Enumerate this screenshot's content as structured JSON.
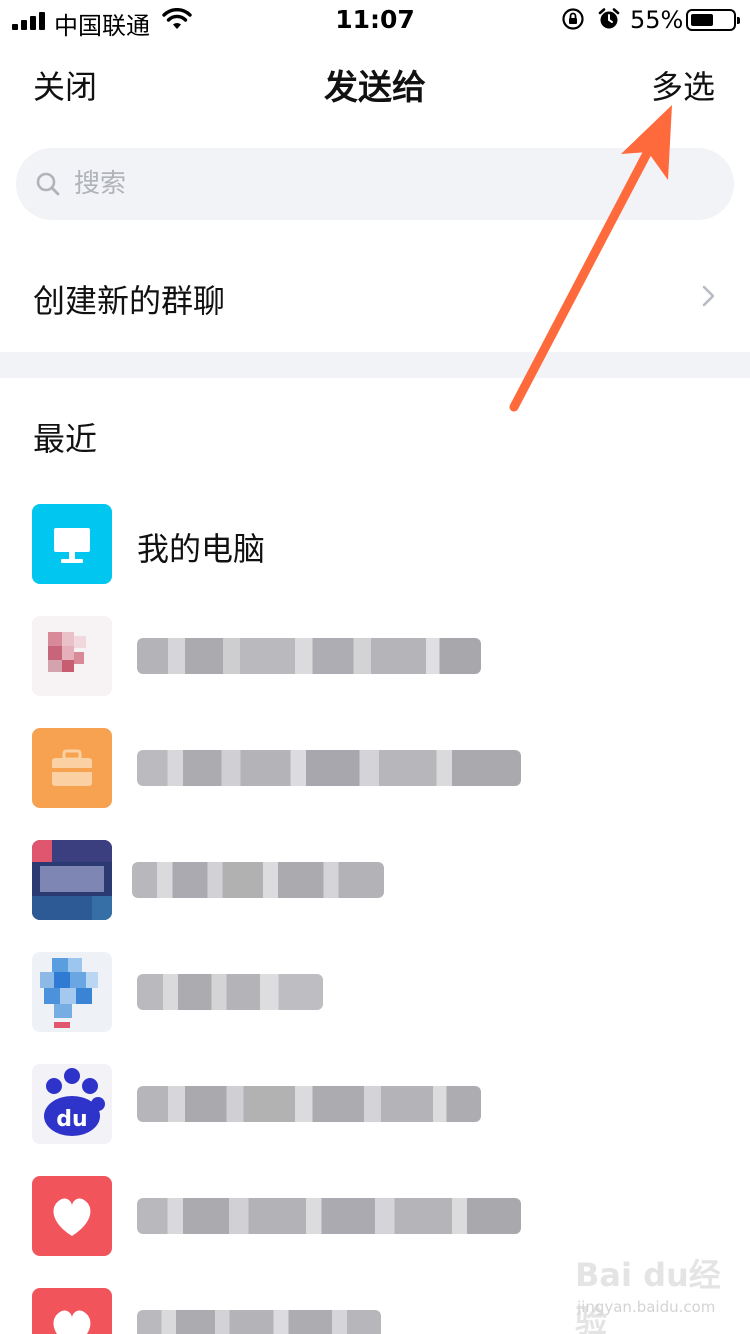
{
  "status_bar": {
    "carrier": "中国联通",
    "time": "11:07",
    "battery_percent": "55%",
    "battery_level": 0.55
  },
  "nav": {
    "close_label": "关闭",
    "title": "发送给",
    "multi_select_label": "多选"
  },
  "search": {
    "placeholder": "搜索"
  },
  "create_group": {
    "label": "创建新的群聊"
  },
  "recent": {
    "header": "最近",
    "items": [
      {
        "name": "我的电脑",
        "avatar_icon": "computer-icon",
        "avatar_color": "#00c6f0"
      }
    ]
  },
  "colors": {
    "accent_arrow": "#ff6a3d",
    "divider_background": "#f2f3f7",
    "my_computer_blue": "#00c6f0"
  },
  "watermark": {
    "logo": "Bai du经验",
    "url": "jingyan.baidu.com"
  }
}
